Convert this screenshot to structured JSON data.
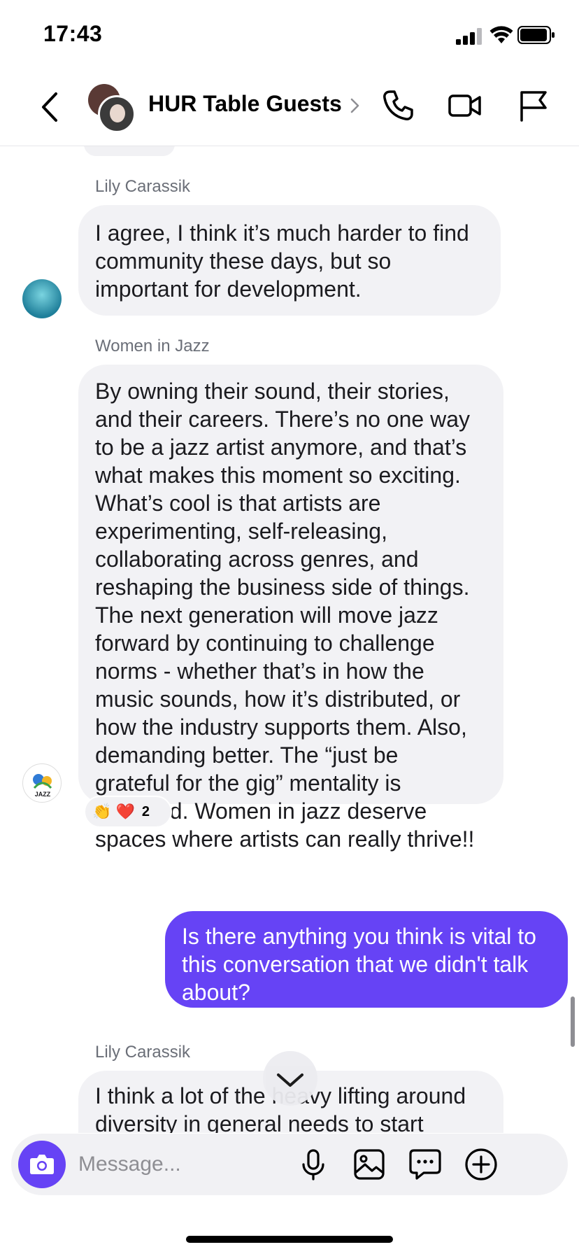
{
  "status_bar": {
    "time": "17:43"
  },
  "header": {
    "title": "HUR Table Guests"
  },
  "messages": [
    {
      "sender": "Lily Carassik",
      "lines": [
        "I agree, I think it’s much harder to find",
        "community these days, but so",
        "important for development."
      ]
    },
    {
      "sender": "Women in Jazz",
      "lines": [
        "By owning their sound, their stories,",
        "and their careers. There’s no one way",
        "to be a jazz artist anymore, and that’s",
        "what makes this moment so exciting.",
        "What’s cool is that artists are",
        "experimenting, self-releasing,",
        "collaborating across genres, and",
        "reshaping the business side of things.",
        "The next generation will move jazz",
        "forward by continuing to challenge",
        "norms - whether that’s in how the",
        "music sounds, how it’s distributed, or",
        "how the industry supports them. Also,",
        "demanding better. The “just be",
        "grateful for the gig” mentality is",
        "outdated. Women in jazz deserve",
        "spaces where artists can really thrive!!"
      ],
      "avatar_text": "JAZZ",
      "reactions": {
        "emojis": "👏 ❤️",
        "count": "2"
      }
    },
    {
      "sender": "",
      "lines": [
        "Is there anything you think is vital to",
        "this conversation that we didn't talk",
        "about?"
      ]
    },
    {
      "sender": "Lily Carassik",
      "lines": [
        "I think a lot of the heavy lifting around",
        "diversity in general needs to start"
      ]
    }
  ],
  "composer": {
    "placeholder": "Message..."
  },
  "colors": {
    "accent": "#6643f5",
    "bubble_gray": "#f2f2f5",
    "meta_gray": "#6b6f78"
  },
  "icons": [
    "back-chevron-icon",
    "phone-icon",
    "video-icon",
    "flag-icon",
    "camera-icon",
    "microphone-icon",
    "image-icon",
    "chat-bubble-icon",
    "plus-circle-icon",
    "chevron-down-icon"
  ]
}
